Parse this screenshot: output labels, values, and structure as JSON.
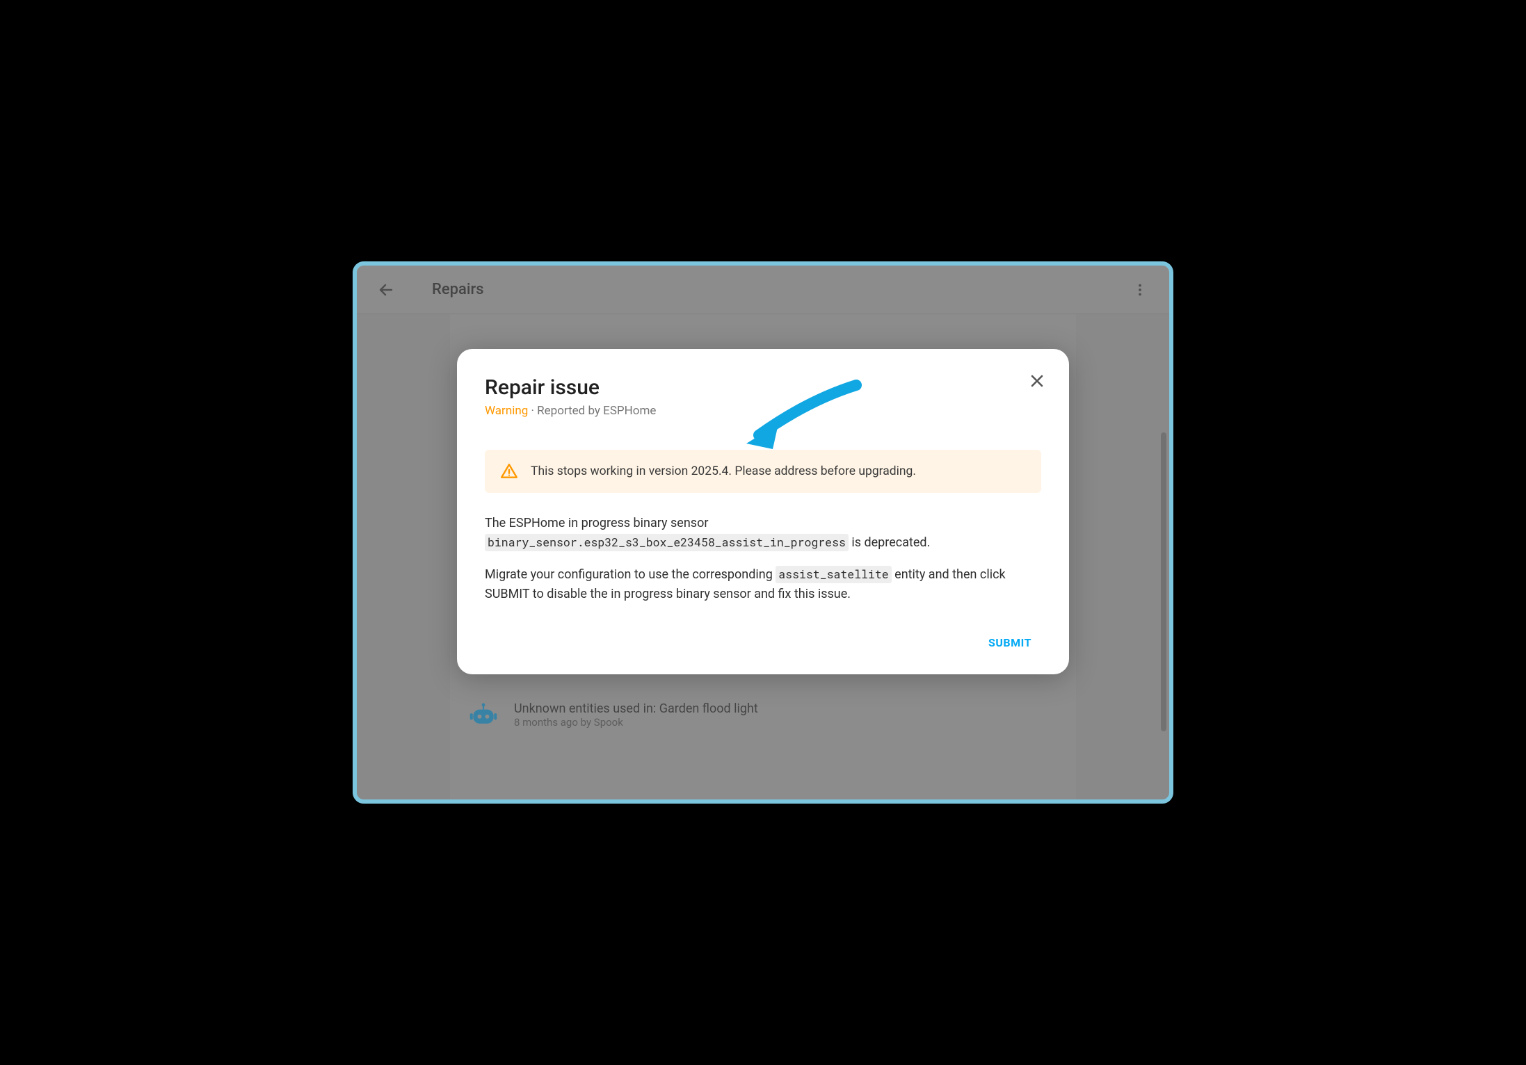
{
  "header": {
    "title": "Repairs"
  },
  "list": {
    "items": [
      {
        "title": "Unknown entities used in: Garden flood light",
        "sub": "8 months ago by Spook"
      }
    ]
  },
  "dialog": {
    "title": "Repair issue",
    "severity": "Warning",
    "reporter": " · Reported by ESPHome",
    "alert": "This stops working in version 2025.4. Please address before upgrading.",
    "body": {
      "p1a": "The ESPHome in progress binary sensor ",
      "code1": "binary_sensor.esp32_s3_box_e23458_assist_in_progress",
      "p1b": " is deprecated.",
      "p2a": "Migrate your configuration to use the corresponding ",
      "code2": "assist_satellite",
      "p2b": " entity and then click SUBMIT to disable the in progress binary sensor and fix this issue."
    },
    "submit": "SUBMIT"
  }
}
